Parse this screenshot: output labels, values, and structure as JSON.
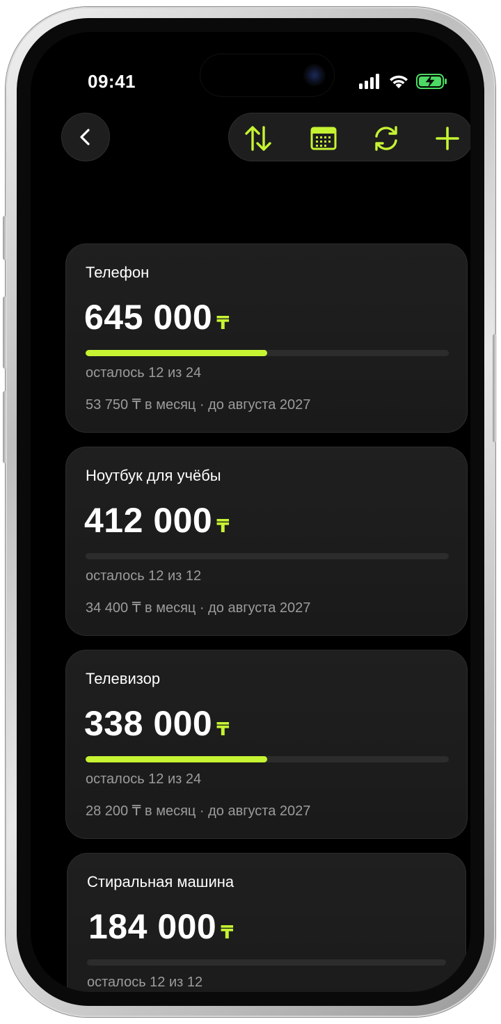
{
  "status_bar": {
    "time": "09:41"
  },
  "colors": {
    "accent": "#c6f432",
    "card_bg": "#1c1c1c",
    "secondary_text": "#9c9c9c"
  },
  "toolbar": {
    "icons": [
      "sort-arrows-icon",
      "calendar-icon",
      "refresh-icon",
      "plus-icon"
    ]
  },
  "cards": [
    {
      "title": "Телефон",
      "amount": "645 000",
      "currency": "₸",
      "progress": 0.5,
      "remaining": "осталось 12 из 24",
      "monthly": "53 750 ₸ в месяц · до августа 2027"
    },
    {
      "title": "Ноутбук для учёбы",
      "amount": "412 000",
      "currency": "₸",
      "progress": 0,
      "remaining": "осталось 12 из 12",
      "monthly": "34 400 ₸ в месяц · до августа 2027"
    },
    {
      "title": "Телевизор",
      "amount": "338 000",
      "currency": "₸",
      "progress": 0.5,
      "remaining": "осталось 12 из 24",
      "monthly": "28 200 ₸ в месяц · до августа 2027"
    },
    {
      "title": "Стиральная машина",
      "amount": "184 000",
      "currency": "₸",
      "progress": 0,
      "remaining": "осталось 12 из 12",
      "monthly": ""
    }
  ]
}
